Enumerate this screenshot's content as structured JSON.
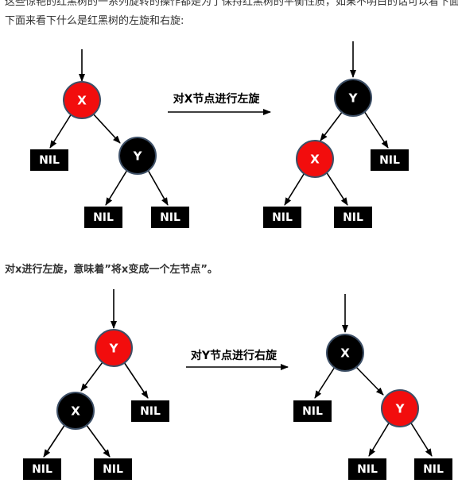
{
  "text": {
    "cut_line": "这些惊艳的红黑树的一系列旋转的操作都是为了保持红黑树的平衡性质，如果不明白的话可以看下面的图片",
    "intro": "下面来看下什么是红黑树的左旋和右旋:",
    "left_caption": "对x进行左旋，意味着”将x变成一个左节点”。"
  },
  "colors": {
    "red_node": "#f20d0d",
    "black_node": "#000000",
    "nil_box": "#000000",
    "node_border": "#3d4f66",
    "edge": "#000000"
  },
  "diagrams": [
    {
      "id": "left-rotation",
      "operation_label": "对X节点进行左旋",
      "before": {
        "root": {
          "label": "X",
          "color": "red"
        },
        "children": [
          {
            "kind": "nil",
            "label": "NIL"
          },
          {
            "kind": "node",
            "label": "Y",
            "color": "black",
            "children": [
              {
                "kind": "nil",
                "label": "NIL"
              },
              {
                "kind": "nil",
                "label": "NIL"
              }
            ]
          }
        ]
      },
      "after": {
        "root": {
          "label": "Y",
          "color": "black"
        },
        "children": [
          {
            "kind": "node",
            "label": "X",
            "color": "red",
            "children": [
              {
                "kind": "nil",
                "label": "NIL"
              },
              {
                "kind": "nil",
                "label": "NIL"
              }
            ]
          },
          {
            "kind": "nil",
            "label": "NIL"
          }
        ]
      }
    },
    {
      "id": "right-rotation",
      "operation_label": "对Y节点进行右旋",
      "before": {
        "root": {
          "label": "Y",
          "color": "red"
        },
        "children": [
          {
            "kind": "node",
            "label": "X",
            "color": "black",
            "children": [
              {
                "kind": "nil",
                "label": "NIL"
              },
              {
                "kind": "nil",
                "label": "NIL"
              }
            ]
          },
          {
            "kind": "nil",
            "label": "NIL"
          }
        ]
      },
      "after": {
        "root": {
          "label": "X",
          "color": "black"
        },
        "children": [
          {
            "kind": "nil",
            "label": "NIL"
          },
          {
            "kind": "node",
            "label": "Y",
            "color": "red",
            "children": [
              {
                "kind": "nil",
                "label": "NIL"
              },
              {
                "kind": "nil",
                "label": "NIL"
              }
            ]
          }
        ]
      }
    }
  ]
}
